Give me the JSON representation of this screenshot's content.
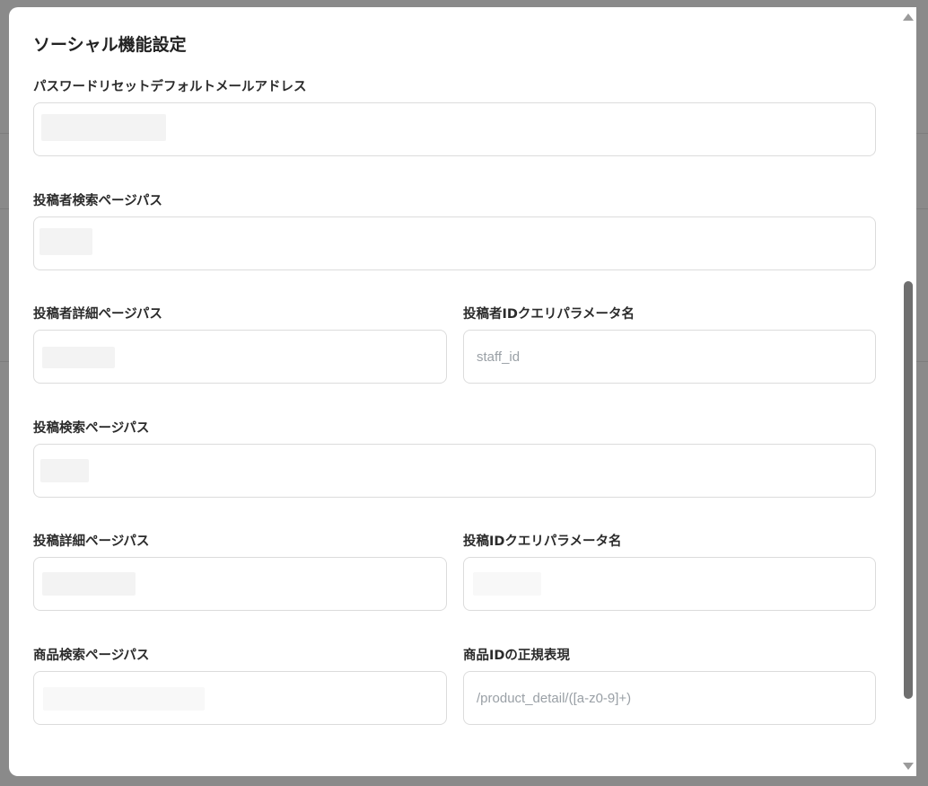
{
  "modal": {
    "title": "ソーシャル機能設定"
  },
  "fields": {
    "password_reset_email": {
      "label": "パスワードリセットデフォルトメールアドレス",
      "value": "",
      "placeholder": ""
    },
    "author_search_path": {
      "label": "投稿者検索ページパス",
      "value": "",
      "placeholder": ""
    },
    "author_detail_path": {
      "label": "投稿者詳細ページパス",
      "value": "",
      "placeholder": ""
    },
    "author_id_param": {
      "label": "投稿者IDクエリパラメータ名",
      "value": "",
      "placeholder": "staff_id"
    },
    "post_search_path": {
      "label": "投稿検索ページパス",
      "value": "",
      "placeholder": ""
    },
    "post_detail_path": {
      "label": "投稿詳細ページパス",
      "value": "",
      "placeholder": ""
    },
    "post_id_param": {
      "label": "投稿IDクエリパラメータ名",
      "value": "",
      "placeholder": ""
    },
    "product_search_path": {
      "label": "商品検索ページパス",
      "value": "",
      "placeholder": ""
    },
    "product_id_regex": {
      "label": "商品IDの正規表現",
      "value": "",
      "placeholder": "/product_detail/([a-z0-9]+)"
    }
  },
  "icons": {
    "scroll_up": "triangle-up-icon",
    "scroll_down": "triangle-down-icon"
  },
  "colors": {
    "overlay": "#8c8c8c",
    "modal_bg": "#ffffff",
    "input_border": "#dcdcdc",
    "placeholder": "#9aa0a6",
    "label": "#2b2b2b",
    "scroll_thumb": "#6f6f6f"
  }
}
